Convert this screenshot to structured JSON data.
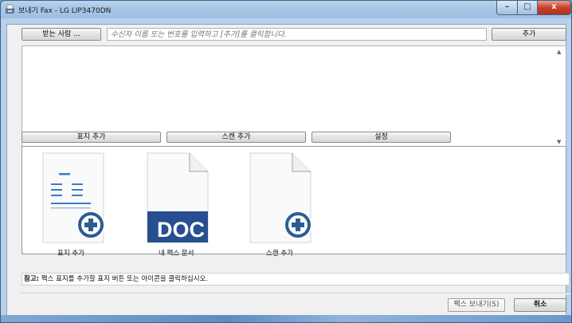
{
  "window": {
    "title": "보내기 Fax - LG LIP3470DN",
    "controls": {
      "minimize": "–",
      "maximize": "□",
      "close": "x"
    }
  },
  "recipients": {
    "to_button": "받는 사람 ...",
    "input_placeholder": "수신자 이름 또는 번호를 입력하고 [추가]를 클릭합니다.",
    "add_button": "추가"
  },
  "actions": {
    "add_cover": "표지 추가",
    "add_scan": "스캔 추가",
    "settings": "설정"
  },
  "tiles": [
    {
      "label": "표지 추가",
      "icon": "cover-page-add-icon"
    },
    {
      "label": "내 팩스 문서",
      "icon": "doc-file-icon",
      "badge": "DOC"
    },
    {
      "label": "스캔 추가",
      "icon": "scan-page-add-icon"
    }
  ],
  "note": {
    "prefix": "참고:",
    "text": " 팩스 표지를 추가할 표지 버튼 또는 아이콘을 클릭하십시오."
  },
  "footer": {
    "send": "팩스 보내기(S)",
    "cancel": "취소"
  },
  "colors": {
    "accent": "#2f5e9c",
    "doc_blue": "#274f90"
  }
}
